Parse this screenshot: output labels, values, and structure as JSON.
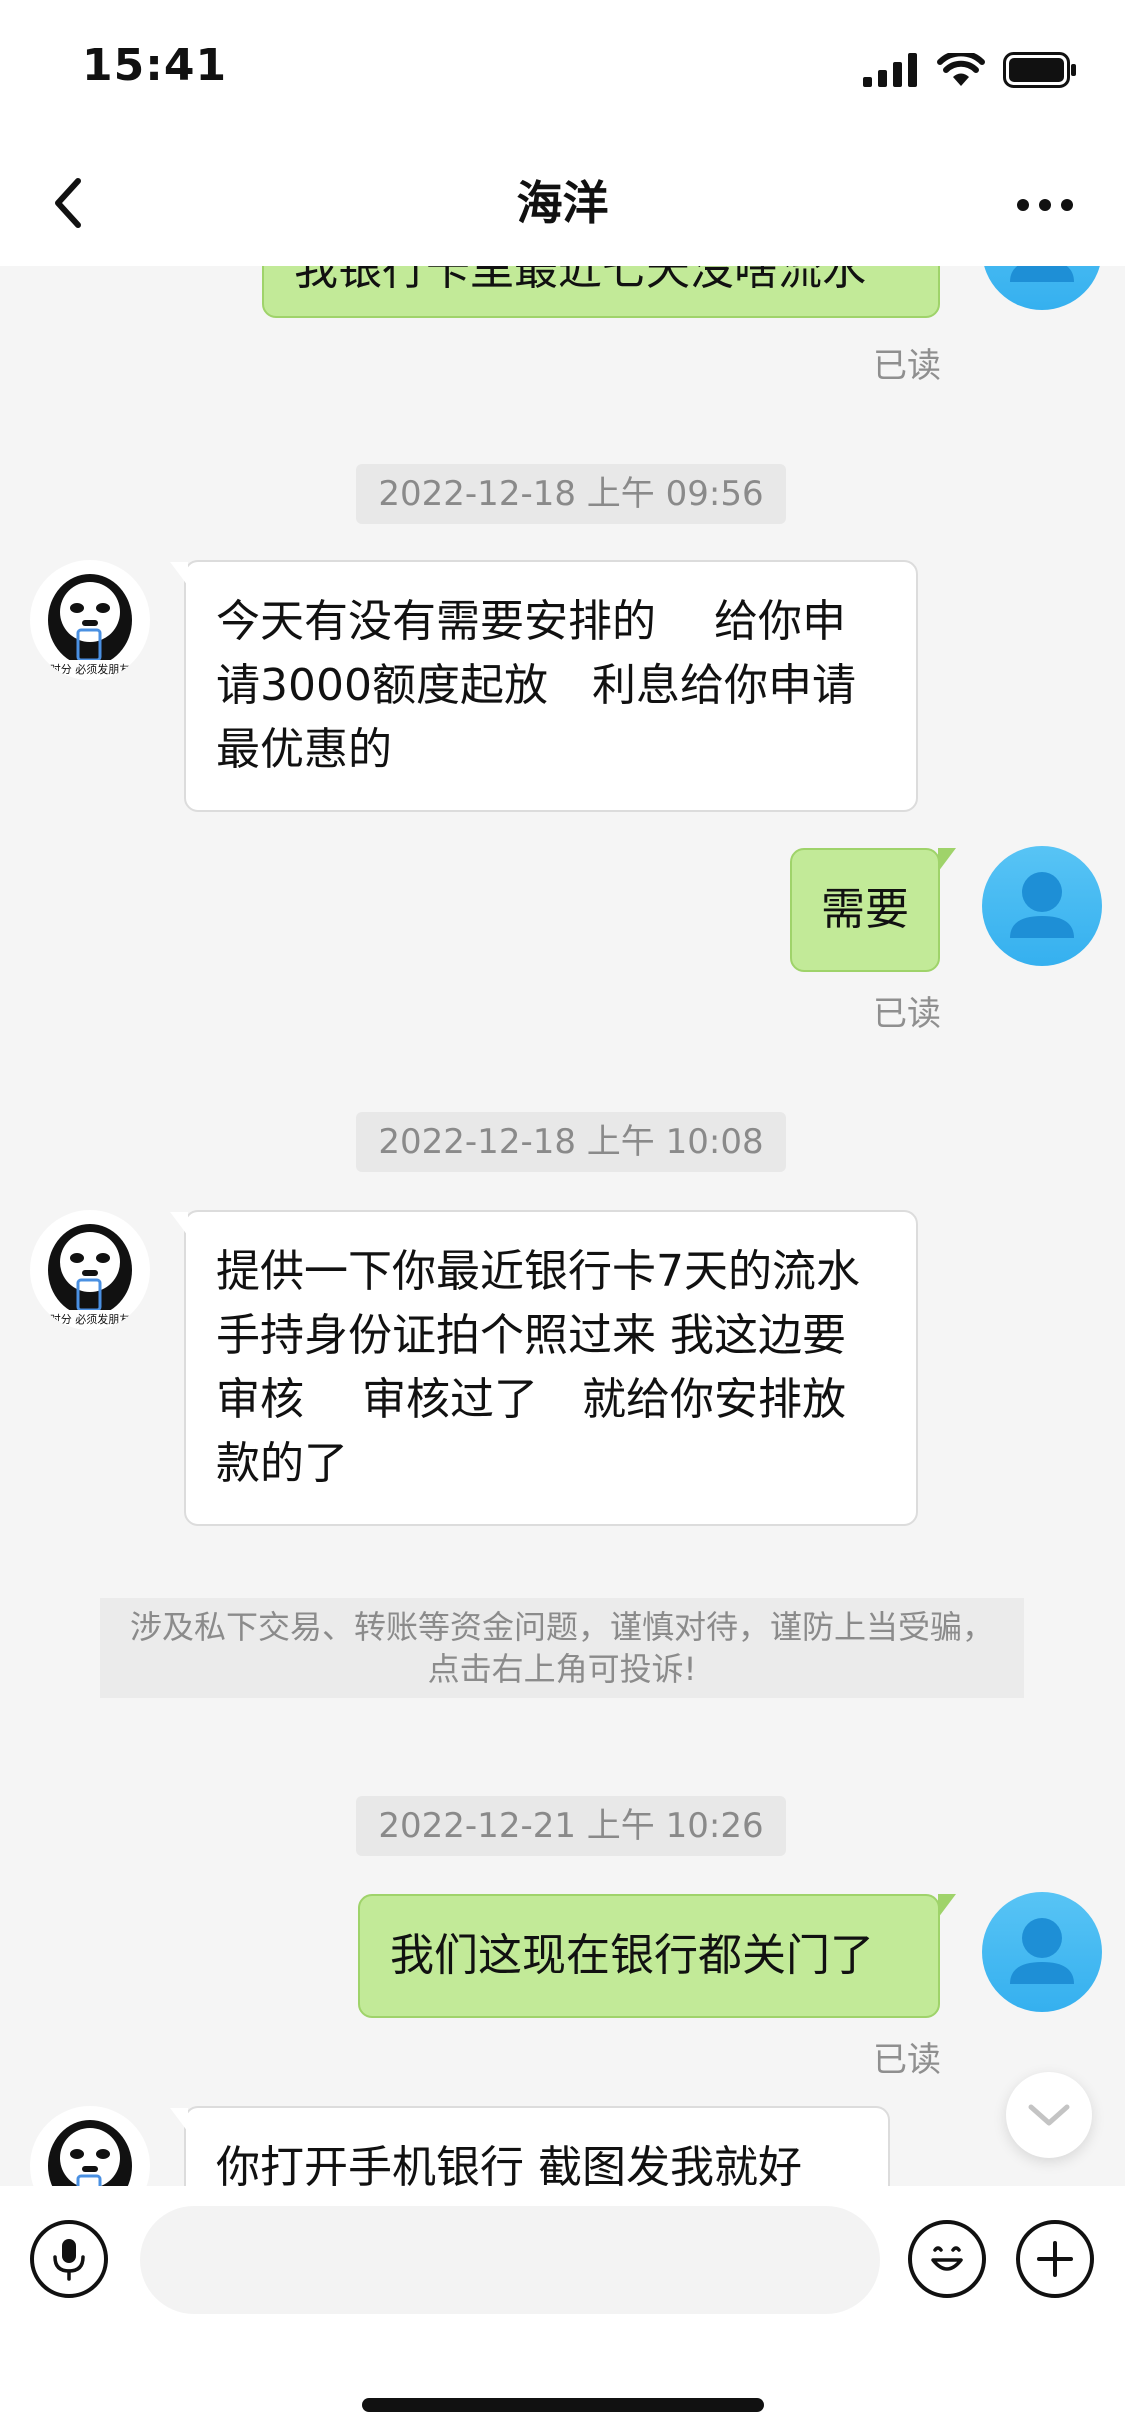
{
  "status_bar": {
    "time": "15:41"
  },
  "nav": {
    "title": "海洋"
  },
  "avatar_caption": "时分 必须发朋友",
  "messages": {
    "m0_text": "我银行卡里最近七天没啥流水",
    "m0_read": "已读",
    "ts1": "2022-12-18 上午 09:56",
    "m1_text": "今天有没有需要安排的　 给你申请3000额度起放　利息给你申请最优惠的",
    "m2_text": "需要",
    "m2_read": "已读",
    "ts2": "2022-12-18 上午 10:08",
    "m3_text": "提供一下你最近银行卡7天的流水  手持身份证拍个照过来  我这边要审核　 审核过了　就给你安排放款的了",
    "notice": "涉及私下交易、转账等资金问题，谨慎对待，谨防上当受骗，点击右上角可投诉!",
    "ts3": "2022-12-21 上午 10:26",
    "m4_text": "我们这现在银行都关门了",
    "m4_read": "已读",
    "m5_text": "你打开手机银行  截图发我就好"
  },
  "input": {
    "placeholder": ""
  },
  "colors": {
    "self_bubble": "#c2ea98",
    "self_bubble_border": "#9fd36a",
    "other_bubble": "#ffffff",
    "avatar_blue": "#3db3f0",
    "chat_bg": "#f5f5f5"
  },
  "icons": {
    "back": "chevron-left-icon",
    "more": "more-dots-icon",
    "voice": "microphone-icon",
    "emoji": "smile-icon",
    "plus": "plus-icon",
    "scroll_down": "chevron-down-icon"
  }
}
